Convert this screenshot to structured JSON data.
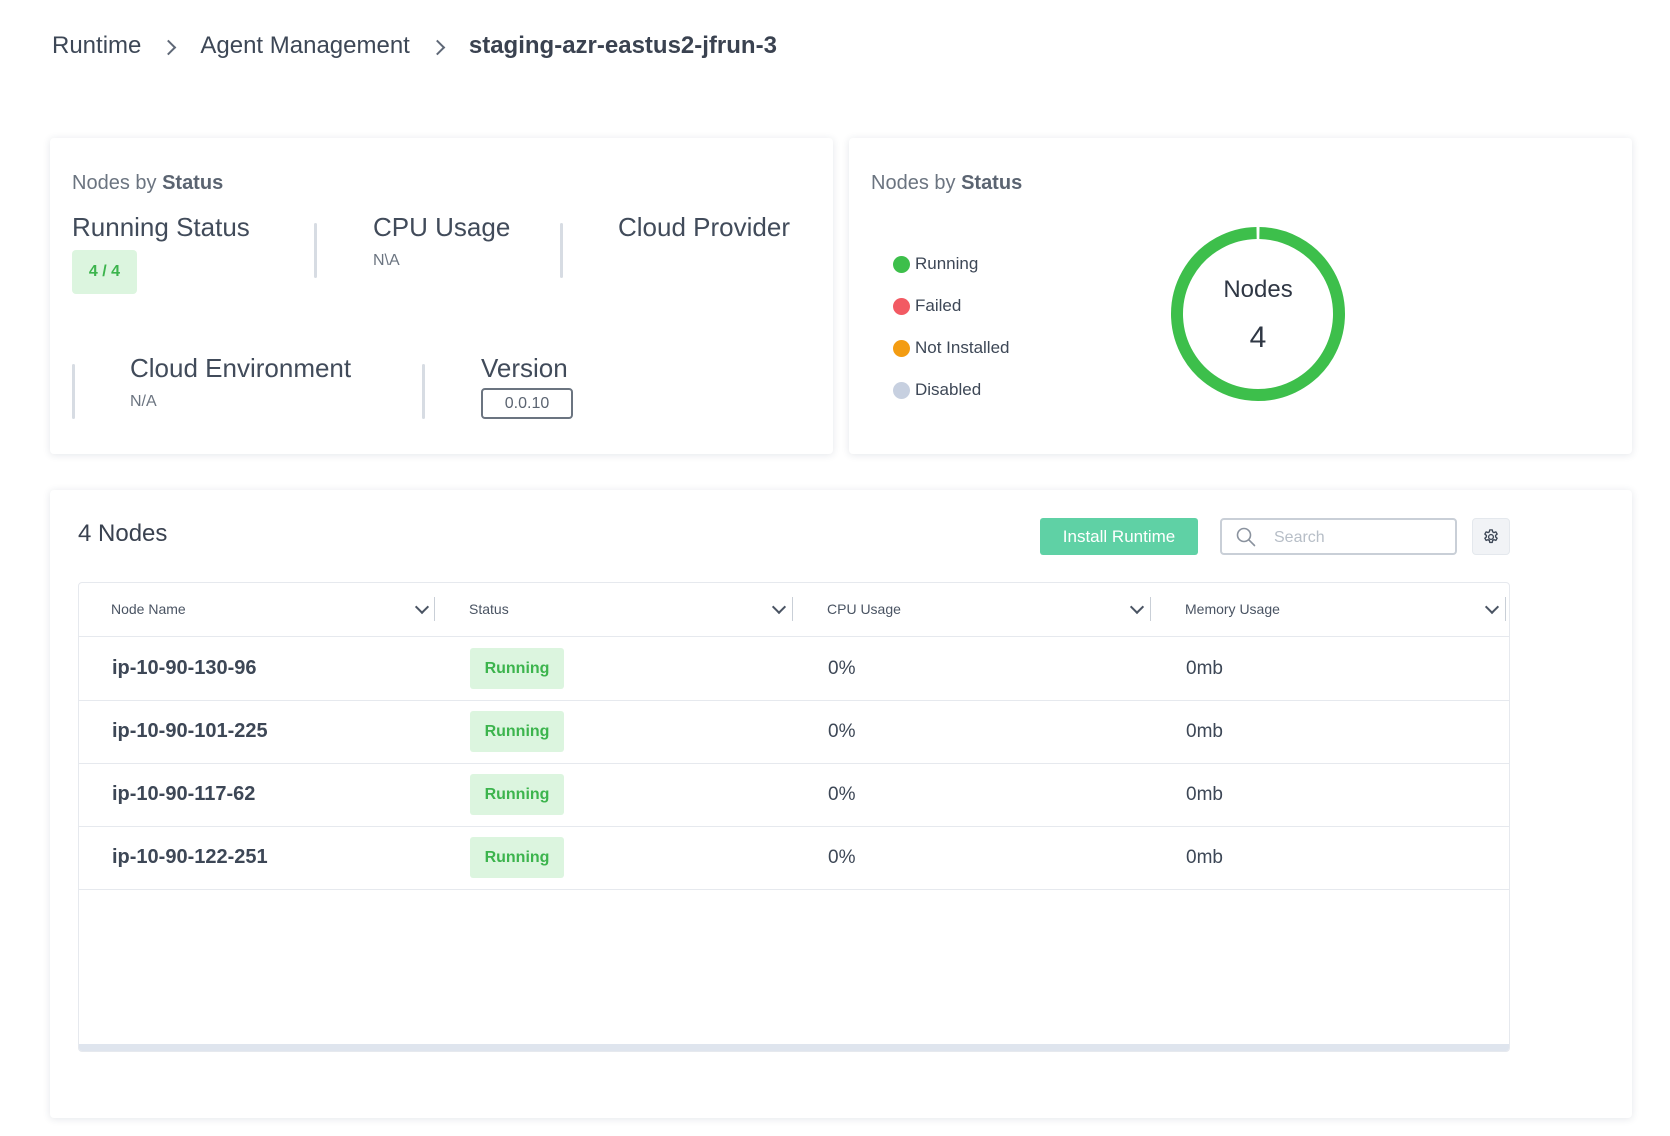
{
  "breadcrumb": {
    "items": [
      "Runtime",
      "Agent Management",
      "staging-azr-eastus2-jfrun-3"
    ]
  },
  "summary_card": {
    "title_prefix": "Nodes by",
    "title_bold": "Status",
    "running_status": {
      "label": "Running Status",
      "value": "4 / 4"
    },
    "cpu_usage": {
      "label": "CPU Usage",
      "value": "N\\A"
    },
    "cloud_provider": {
      "label": "Cloud Provider",
      "value": ""
    },
    "cloud_environment": {
      "label": "Cloud Environment",
      "value": "N/A"
    },
    "version": {
      "label": "Version",
      "value": "0.0.10"
    }
  },
  "status_card": {
    "title_prefix": "Nodes by",
    "title_bold": "Status",
    "legend": [
      {
        "label": "Running",
        "color": "#3dbf4b"
      },
      {
        "label": "Failed",
        "color": "#f25a63"
      },
      {
        "label": "Not Installed",
        "color": "#f39c12"
      },
      {
        "label": "Disabled",
        "color": "#c7d0e0"
      }
    ],
    "donut_title": "Nodes",
    "donut_total": "4",
    "chart_data": {
      "type": "pie",
      "categories": [
        "Running",
        "Failed",
        "Not Installed",
        "Disabled"
      ],
      "values": [
        4,
        0,
        0,
        0
      ],
      "colors": [
        "#3dbf4b",
        "#f25a63",
        "#f39c12",
        "#c7d0e0"
      ]
    }
  },
  "nodes_panel": {
    "title": "4 Nodes",
    "install_button": "Install Runtime",
    "search_placeholder": "Search",
    "columns": [
      "Node Name",
      "Status",
      "CPU Usage",
      "Memory Usage"
    ],
    "rows": [
      {
        "name": "ip-10-90-130-96",
        "status": "Running",
        "cpu": "0%",
        "memory": "0mb"
      },
      {
        "name": "ip-10-90-101-225",
        "status": "Running",
        "cpu": "0%",
        "memory": "0mb"
      },
      {
        "name": "ip-10-90-117-62",
        "status": "Running",
        "cpu": "0%",
        "memory": "0mb"
      },
      {
        "name": "ip-10-90-122-251",
        "status": "Running",
        "cpu": "0%",
        "memory": "0mb"
      }
    ]
  }
}
